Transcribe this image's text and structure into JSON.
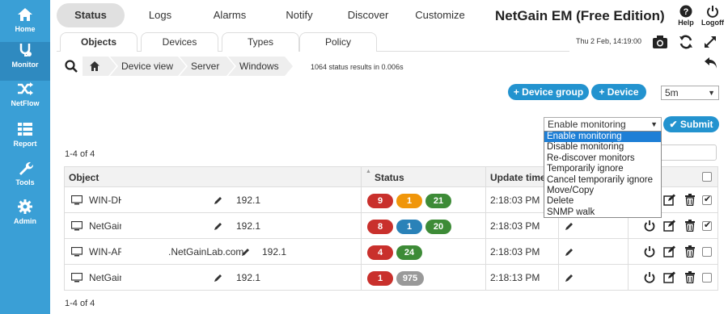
{
  "sidebar": {
    "items": [
      {
        "label": "Home",
        "icon": "home-icon"
      },
      {
        "label": "Monitor",
        "icon": "stethoscope-icon"
      },
      {
        "label": "NetFlow",
        "icon": "shuffle-icon"
      },
      {
        "label": "Report",
        "icon": "grid-icon"
      },
      {
        "label": "Tools",
        "icon": "wrench-icon"
      },
      {
        "label": "Admin",
        "icon": "gear-icon"
      }
    ]
  },
  "topnav": {
    "items": [
      "Status",
      "Logs",
      "Alarms",
      "Notify",
      "Discover",
      "Customize"
    ]
  },
  "app": {
    "title": "NetGain EM (Free Edition)",
    "help_label": "Help",
    "logoff_label": "Logoff",
    "datetime": "Thu 2 Feb, 14:19:00"
  },
  "tabs": [
    "Objects",
    "Devices",
    "Types",
    "Policy"
  ],
  "breadcrumb": [
    "Device view",
    "Server",
    "Windows"
  ],
  "results_text": "1064 status results in 0.006s",
  "buttons": {
    "device_group": "+ Device group",
    "device": "+ Device",
    "submit": "✔ Submit"
  },
  "interval_select": {
    "value": "5m"
  },
  "action_select": {
    "value": "Enable monitoring",
    "options": [
      "Enable monitoring",
      "Disable monitoring",
      "Re-discover monitors",
      "Temporarily ignore",
      "Cancel temporarily ignore",
      "Move/Copy",
      "Delete",
      "SNMP walk"
    ]
  },
  "count_text": "1-4 of 4",
  "table": {
    "headers": {
      "object": "Object",
      "status": "Status",
      "update_time": "Update time"
    },
    "rows": [
      {
        "name": "WIN-DH",
        "domain": "",
        "ip": "192.1",
        "badges": [
          {
            "v": "9",
            "c": "red"
          },
          {
            "v": "1",
            "c": "orange"
          },
          {
            "v": "21",
            "c": "green"
          }
        ],
        "time": "2:18:03 PM",
        "checked": true,
        "show_actions": false
      },
      {
        "name": "NetGain",
        "domain": "",
        "ip": "192.1",
        "badges": [
          {
            "v": "8",
            "c": "red"
          },
          {
            "v": "1",
            "c": "blue"
          },
          {
            "v": "20",
            "c": "green"
          }
        ],
        "time": "2:18:03 PM",
        "checked": true,
        "show_actions": true
      },
      {
        "name": "WIN-ARI",
        "domain": ".NetGainLab.com",
        "ip": "192.1(",
        "badges": [
          {
            "v": "4",
            "c": "red"
          },
          {
            "v": "24",
            "c": "green"
          }
        ],
        "time": "2:18:03 PM",
        "checked": false,
        "show_actions": true
      },
      {
        "name": "NetGainI",
        "domain": "",
        "ip": "192.1",
        "badges": [
          {
            "v": "1",
            "c": "red"
          },
          {
            "v": "975",
            "c": "gray"
          }
        ],
        "time": "2:18:13 PM",
        "checked": false,
        "show_actions": true
      }
    ]
  },
  "footer_count": "1-4 of 4"
}
